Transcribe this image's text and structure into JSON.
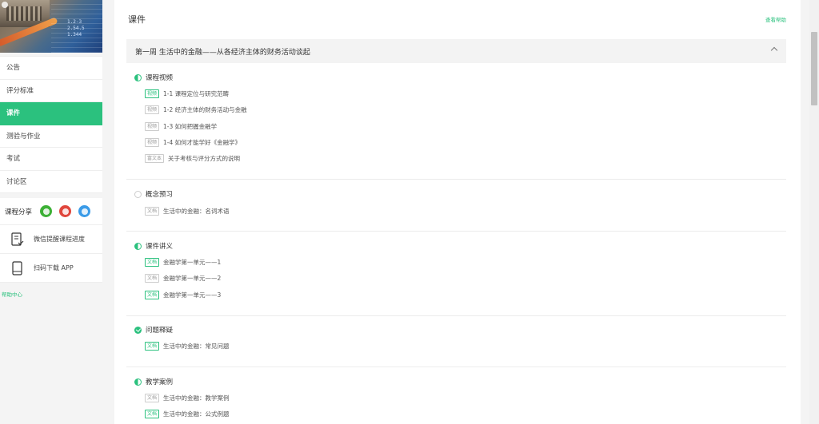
{
  "sidebar": {
    "cover_digits": "1.2-3\n2.54.5\n1.344",
    "nav": [
      {
        "label": "公告"
      },
      {
        "label": "评分标准"
      },
      {
        "label": "课件"
      },
      {
        "label": "测验与作业"
      },
      {
        "label": "考试"
      },
      {
        "label": "讨论区"
      }
    ],
    "share_label": "课程分享",
    "wechat_reminder": "微信提醒课程进度",
    "download_app": "扫码下载 APP",
    "help_center": "帮助中心"
  },
  "main": {
    "title": "课件",
    "help_link": "查看帮助",
    "week_title": "第一周 生活中的金融——从各经济主体的财务活动谈起",
    "sections": [
      {
        "title": "课程视频",
        "status": "half",
        "items": [
          {
            "badge": "视频",
            "active": true,
            "text": "1-1  课程定位与研究范畴"
          },
          {
            "badge": "视频",
            "active": false,
            "text": "1-2  经济主体的财务活动与金融"
          },
          {
            "badge": "视频",
            "active": false,
            "text": "1-3   如何把握金融学"
          },
          {
            "badge": "视频",
            "active": false,
            "text": "1-4   如何才能学好《金融学》"
          },
          {
            "badge": "富文本",
            "active": false,
            "text": "关于考核与评分方式的说明"
          }
        ]
      },
      {
        "title": "概念预习",
        "status": "empty",
        "items": [
          {
            "badge": "文档",
            "active": false,
            "text": "生活中的金融：名词术语"
          }
        ]
      },
      {
        "title": "课件讲义",
        "status": "half",
        "items": [
          {
            "badge": "文档",
            "active": true,
            "text": "金融学第一单元——1"
          },
          {
            "badge": "文档",
            "active": false,
            "text": "金融学第一单元——2"
          },
          {
            "badge": "文档",
            "active": true,
            "text": "金融学第一单元——3"
          }
        ]
      },
      {
        "title": "问题释疑",
        "status": "full",
        "items": [
          {
            "badge": "文档",
            "active": true,
            "text": "生活中的金融：常见问题"
          }
        ]
      },
      {
        "title": "教学案例",
        "status": "half",
        "items": [
          {
            "badge": "文档",
            "active": false,
            "text": "生活中的金融：教学案例"
          },
          {
            "badge": "文档",
            "active": true,
            "text": "生活中的金融：公式例题"
          }
        ]
      }
    ]
  },
  "colors": {
    "accent": "#2bc17e",
    "background": "#f4f4f4",
    "panel": "#ffffff"
  }
}
